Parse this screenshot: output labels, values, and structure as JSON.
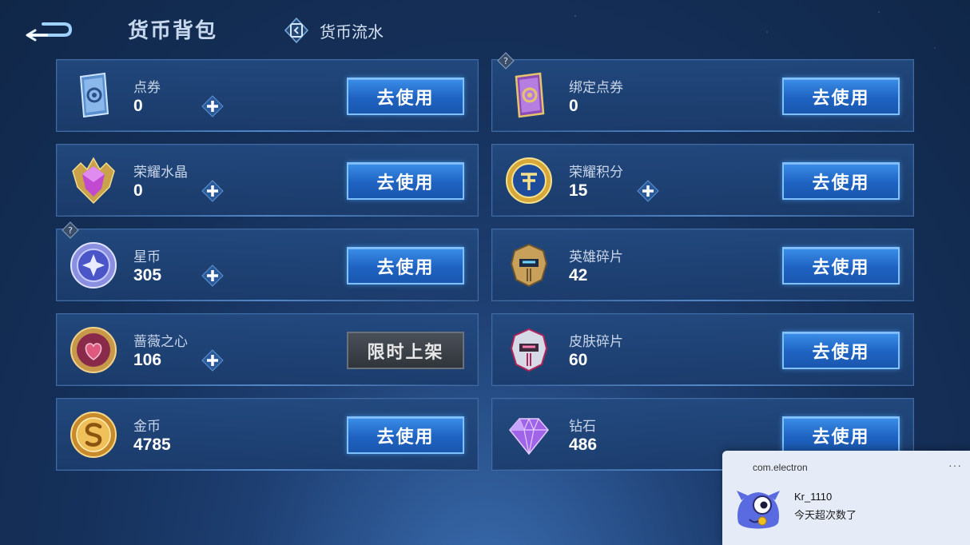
{
  "header": {
    "title": "货币背包",
    "flow_label": "货币流水"
  },
  "cards": [
    {
      "name": "点券",
      "value": "0",
      "button": "去使用",
      "icon": "ticket-icon",
      "has_plus": true,
      "has_help": false,
      "limited": false
    },
    {
      "name": "绑定点券",
      "value": "0",
      "button": "去使用",
      "icon": "bound-ticket-icon",
      "has_plus": false,
      "has_help": true,
      "limited": false
    },
    {
      "name": "荣耀水晶",
      "value": "0",
      "button": "去使用",
      "icon": "glory-crystal-icon",
      "has_plus": true,
      "has_help": false,
      "limited": false
    },
    {
      "name": "荣耀积分",
      "value": "15",
      "button": "去使用",
      "icon": "glory-points-icon",
      "has_plus": true,
      "has_help": false,
      "limited": false
    },
    {
      "name": "星币",
      "value": "305",
      "button": "去使用",
      "icon": "star-coin-icon",
      "has_plus": true,
      "has_help": true,
      "limited": false
    },
    {
      "name": "英雄碎片",
      "value": "42",
      "button": "去使用",
      "icon": "hero-fragment-icon",
      "has_plus": false,
      "has_help": false,
      "limited": false
    },
    {
      "name": "蔷薇之心",
      "value": "106",
      "button": "限时上架",
      "icon": "rose-heart-icon",
      "has_plus": true,
      "has_help": false,
      "limited": true
    },
    {
      "name": "皮肤碎片",
      "value": "60",
      "button": "去使用",
      "icon": "skin-fragment-icon",
      "has_plus": false,
      "has_help": false,
      "limited": false
    },
    {
      "name": "金币",
      "value": "4785",
      "button": "去使用",
      "icon": "gold-coin-icon",
      "has_plus": false,
      "has_help": false,
      "limited": false
    },
    {
      "name": "钻石",
      "value": "486",
      "button": "去使用",
      "icon": "diamond-icon",
      "has_plus": false,
      "has_help": false,
      "limited": false
    }
  ],
  "notification": {
    "app": "com.electron",
    "more": "···",
    "sender": "Kr_1110",
    "message": "今天超次数了"
  },
  "colors": {
    "background": "#15305a",
    "card": "#234a80",
    "button_blue": "#2a75d6",
    "button_limited": "#3a3f46"
  }
}
